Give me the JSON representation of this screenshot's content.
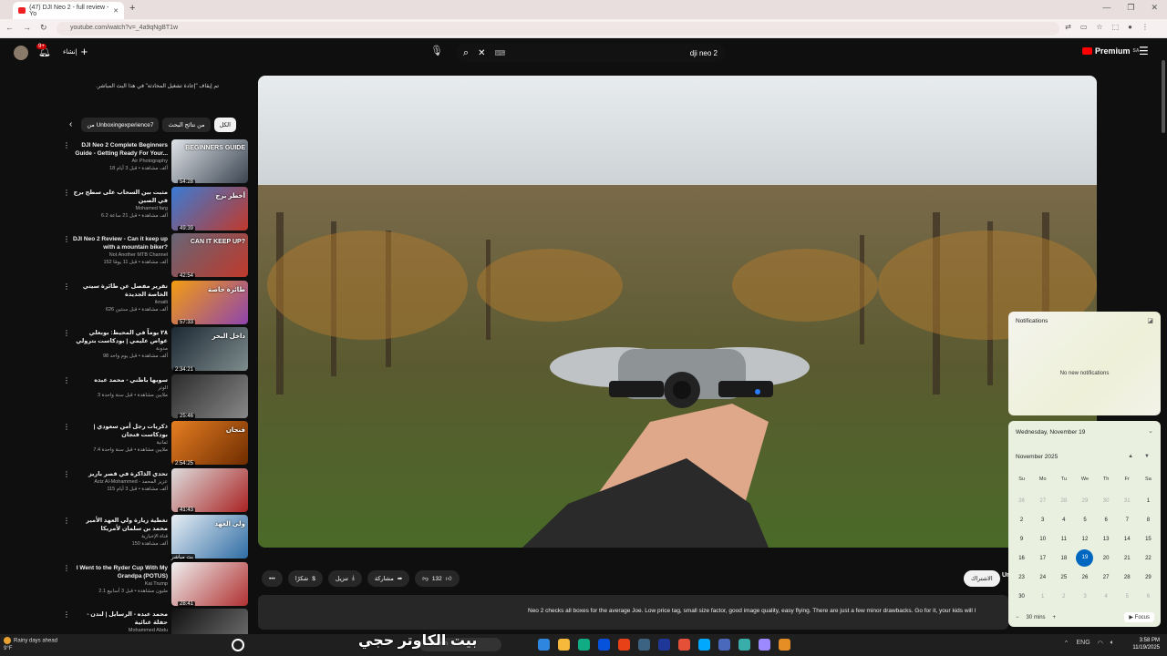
{
  "browser": {
    "tab_title": "(47) DJI Neo 2 - full review - Yo",
    "new_tab": "+",
    "url": "youtube.com/watch?v=_4a9qNgBT1w",
    "window_controls": [
      "—",
      "❐",
      "✕"
    ]
  },
  "header": {
    "notification_count": "9+",
    "create_label": "إنشاء",
    "search_query": "dji neo 2",
    "premium_label": "Premium",
    "premium_region": "SA"
  },
  "sidebar": {
    "notice": "تم إيقاف \"إعادة تشغيل المحادثة\" في هذا البث المباشر.",
    "chips": [
      "الكل",
      "من نتائج البحث",
      "من Unboxingexperience7"
    ],
    "recommendations": [
      {
        "title": "DJI Neo 2 Complete Beginners Guide - Getting Ready For Your...",
        "channel": "Air Photography",
        "meta": "18 ألف مشاهدة • قبل 3 أيام",
        "duration": "54:28",
        "thumb_text": "BEGINNERS GUIDE",
        "colors": [
          "#dfe3e8",
          "#3a4450"
        ]
      },
      {
        "title": "مثبت بين السحاب على سطح برج في الصين",
        "channel": "Mohamed farg",
        "meta": "6.2 ألف مشاهدة • قبل 21 ساعة",
        "duration": "49:39",
        "thumb_text": "أخطر برج",
        "colors": [
          "#3a7bd5",
          "#c0392b"
        ]
      },
      {
        "title": "DJI Neo 2 Review - Can it keep up with a mountain biker?",
        "channel": "Not Another MTB Channel",
        "meta": "152 ألف مشاهدة • قبل 11 يومًا",
        "duration": "42:54",
        "thumb_text": "CAN IT KEEP UP?",
        "colors": [
          "#667",
          "#c0392b"
        ]
      },
      {
        "title": "تقرير مفصل عن طائرة سيتي الخاصة الجديدة",
        "channel": "iknaiti",
        "meta": "626 ألف مشاهدة • قبل سنتين",
        "duration": "57:33",
        "thumb_text": "طائرة خاصة",
        "colors": [
          "#f39c12",
          "#8e44ad"
        ]
      },
      {
        "title": "٢٨ يوماً في المحيط: بوبعلي غواص عليمي | بودكاست بترولي",
        "channel": "مدونة",
        "meta": "98 ألف مشاهدة • قبل يوم واحد",
        "duration": "2:34:21",
        "thumb_text": "داخل البحر",
        "colors": [
          "#1c2833",
          "#7f8c8d"
        ]
      },
      {
        "title": "سوبها باطني - محمد عبده",
        "channel": "الوتر",
        "meta": "3 ملايين مشاهدة • قبل سنة واحدة",
        "duration": "25:46",
        "thumb_text": "",
        "colors": [
          "#2c2c2c",
          "#888"
        ]
      },
      {
        "title": "ذكريات رجل أمن سعودي | بودكاست فنجان",
        "channel": "ثمانية",
        "meta": "7.4 ملايين مشاهدة • قبل سنة واحدة",
        "duration": "2:54:25",
        "thumb_text": "فنجان",
        "colors": [
          "#e67e22",
          "#6e2c00"
        ]
      },
      {
        "title": "تحدي الذاكرة في قصر باريز",
        "channel": "Aziz Al-Mohammed - عزيز المحمد",
        "meta": "115 ألف مشاهدة • قبل 3 أيام",
        "duration": "41:43",
        "thumb_text": "",
        "colors": [
          "#ddd",
          "#aa2222"
        ]
      },
      {
        "title": "تغطية زيارة ولي العهد الأمير محمد بن سلمان لأمريكا",
        "channel": "قناة الإخبارية",
        "meta": "150 ألف مشاهدة",
        "duration": "بث مباشر",
        "thumb_text": "ولي العهد",
        "colors": [
          "#e8eef4",
          "#2e6da4"
        ]
      },
      {
        "title": "I Went to the Ryder Cup With My Grandpa (POTUS)",
        "channel": "Kai Trump",
        "meta": "2.1 مليون مشاهدة • قبل 3 أسابيع",
        "duration": "28:41",
        "thumb_text": "",
        "colors": [
          "#efefef",
          "#b03030"
        ]
      },
      {
        "title": "محمد عبده - الرسايل | لندن - حفلة غنائية",
        "channel": "Mohammed Abdu",
        "meta": "",
        "duration": "",
        "thumb_text": "",
        "colors": [
          "#111",
          "#777"
        ]
      }
    ]
  },
  "video": {
    "likes": "132",
    "share_label": "مشاركة",
    "download_label": "تنزيل",
    "thanks_label": "شكرًا",
    "subscribed_label": "الاشتراك",
    "channel_short": "Ur",
    "description": "Neo 2 checks all boxes for the average Joe. Low price tag, small size factor, good image quality, easy flying. There are just a few minor drawbacks. Go for it, your kids will l"
  },
  "notifications": {
    "title": "Notifications",
    "empty": "No new notifications"
  },
  "calendar": {
    "date_header": "Wednesday, November 19",
    "month": "November 2025",
    "weekdays": [
      "Su",
      "Mo",
      "Tu",
      "We",
      "Th",
      "Fr",
      "Sa"
    ],
    "days": [
      [
        "26",
        "o"
      ],
      [
        "27",
        "o"
      ],
      [
        "28",
        "o"
      ],
      [
        "29",
        "o"
      ],
      [
        "30",
        "o"
      ],
      [
        "31",
        "o"
      ],
      [
        "1",
        ""
      ],
      [
        "2",
        ""
      ],
      [
        "3",
        ""
      ],
      [
        "4",
        ""
      ],
      [
        "5",
        ""
      ],
      [
        "6",
        ""
      ],
      [
        "7",
        ""
      ],
      [
        "8",
        ""
      ],
      [
        "9",
        ""
      ],
      [
        "10",
        ""
      ],
      [
        "11",
        ""
      ],
      [
        "12",
        ""
      ],
      [
        "13",
        ""
      ],
      [
        "14",
        ""
      ],
      [
        "15",
        ""
      ],
      [
        "16",
        ""
      ],
      [
        "17",
        ""
      ],
      [
        "18",
        ""
      ],
      [
        "19",
        "today"
      ],
      [
        "20",
        ""
      ],
      [
        "21",
        ""
      ],
      [
        "22",
        ""
      ],
      [
        "23",
        ""
      ],
      [
        "24",
        ""
      ],
      [
        "25",
        ""
      ],
      [
        "26",
        ""
      ],
      [
        "27",
        ""
      ],
      [
        "28",
        ""
      ],
      [
        "29",
        ""
      ],
      [
        "30",
        ""
      ],
      [
        "1",
        "o"
      ],
      [
        "2",
        "o"
      ],
      [
        "3",
        "o"
      ],
      [
        "4",
        "o"
      ],
      [
        "5",
        "o"
      ],
      [
        "6",
        "o"
      ]
    ],
    "focus_minutes": "30 mins",
    "focus_label": "Focus"
  },
  "taskbar": {
    "weather": "Rainy days ahead",
    "weather_temp": "9°F",
    "search_placeholder": "Search",
    "time": "3:58 PM",
    "date": "11/19/2025",
    "lang": "ENG",
    "overlay_caption": "بيت الكاوتر حجي",
    "icon_colors": [
      "#2e86de",
      "#f6b93b",
      "#10ac84",
      "#0652dd",
      "#e84118",
      "#3c6382",
      "#1e3799",
      "#e55039",
      "#00a8ff",
      "#4a69bd",
      "#38ada9",
      "#9c88ff",
      "#e58e26"
    ]
  }
}
